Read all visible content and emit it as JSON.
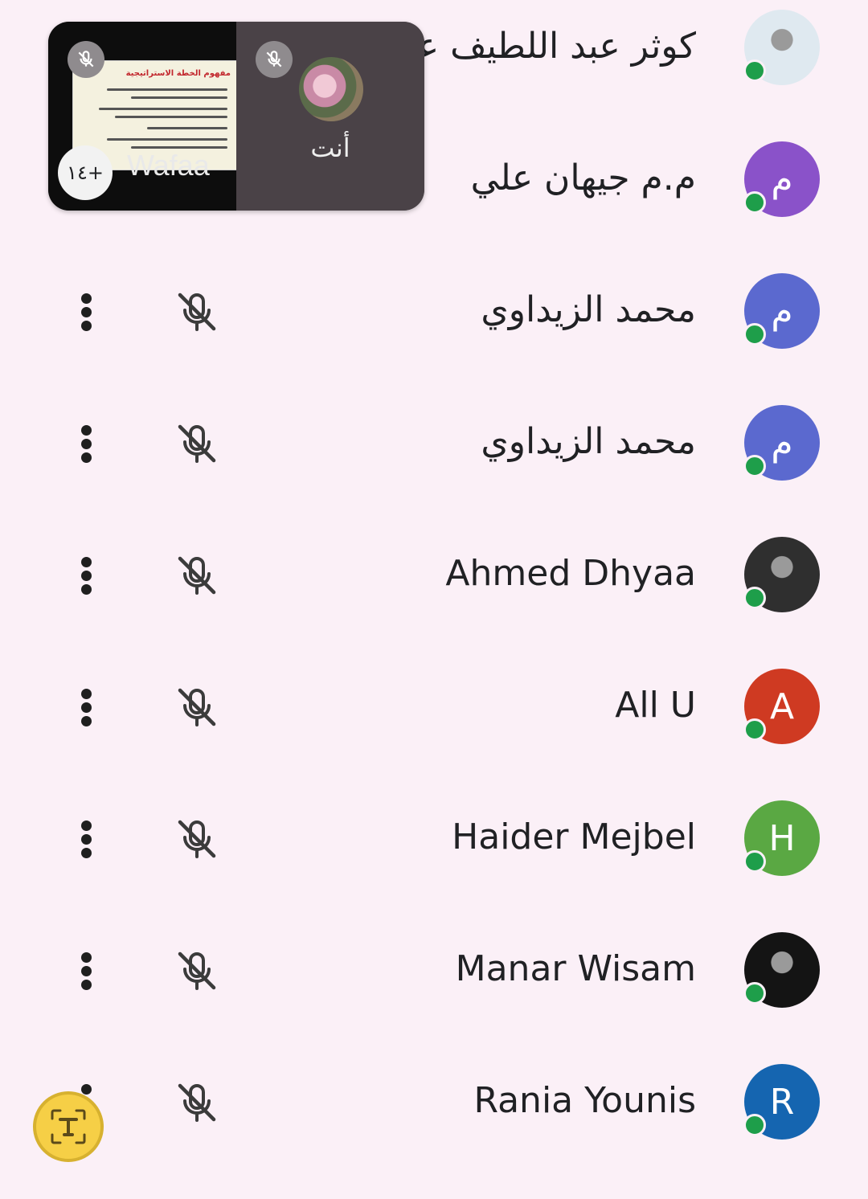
{
  "pip": {
    "presenter_name": "Wafaa",
    "more_count": "١٤+",
    "self_label": "أنت",
    "slide_title": "مفهوم الخطة الاستراتيجية"
  },
  "participants": [
    {
      "name": "كوثر عبد اللطيف عبا",
      "avatar_type": "photo",
      "avatar_letter": "",
      "avatar_color": "#dfe9f0",
      "show_controls": false
    },
    {
      "name": "م.م جيهان علي",
      "avatar_type": "letter",
      "avatar_letter": "م",
      "avatar_color": "#8a52c9",
      "show_controls": false
    },
    {
      "name": "محمد الزيداوي",
      "avatar_type": "letter",
      "avatar_letter": "م",
      "avatar_color": "#5b69cf",
      "show_controls": true
    },
    {
      "name": "محمد الزيداوي",
      "avatar_type": "letter",
      "avatar_letter": "م",
      "avatar_color": "#5b69cf",
      "show_controls": true
    },
    {
      "name": "Ahmed Dhyaa",
      "avatar_type": "photo",
      "avatar_letter": "",
      "avatar_color": "#2f2f2f",
      "show_controls": true
    },
    {
      "name": "All U",
      "avatar_type": "letter",
      "avatar_letter": "A",
      "avatar_color": "#cf3a22",
      "show_controls": true
    },
    {
      "name": "Haider Mejbel",
      "avatar_type": "letter",
      "avatar_letter": "H",
      "avatar_color": "#5aa843",
      "show_controls": true
    },
    {
      "name": "Manar Wisam",
      "avatar_type": "photo",
      "avatar_letter": "",
      "avatar_color": "#141414",
      "show_controls": true
    },
    {
      "name": "Rania Younis",
      "avatar_type": "letter",
      "avatar_letter": "R",
      "avatar_color": "#1565b0",
      "show_controls": true
    }
  ],
  "colors": {
    "background": "#fbf0f7",
    "online_dot": "#1e9e4a",
    "mute_icon": "#3b3b3b",
    "fab": "#f6cf46"
  },
  "icons": {
    "mute": "mic-off-icon",
    "more": "more-vert-icon",
    "fab": "text-scan-icon"
  }
}
